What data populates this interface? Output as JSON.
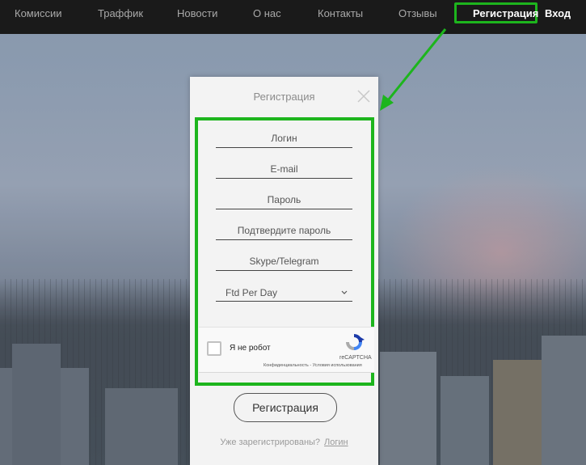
{
  "nav": {
    "items": [
      "Комиссии",
      "Траффик",
      "Новости",
      "О нас",
      "Контакты",
      "Отзывы"
    ],
    "register": "Регистрация",
    "login": "Вход"
  },
  "modal": {
    "title": "Регистрация",
    "fields": {
      "login_placeholder": "Логин",
      "email_placeholder": "E-mail",
      "password_placeholder": "Пароль",
      "confirm_placeholder": "Подтвердите пароль",
      "messenger_placeholder": "Skype/Telegram",
      "select_value": "Ftd Per Day"
    },
    "captcha": {
      "label": "Я не робот",
      "brand": "reCAPTCHA",
      "terms": "Конфиденциальность - Условия использования"
    },
    "submit": "Регистрация",
    "footer_text": "Уже зарегистрированы?",
    "footer_link": "Логин"
  },
  "colors": {
    "highlight": "#1db51d",
    "nav_bg": "#1a1a1a"
  }
}
